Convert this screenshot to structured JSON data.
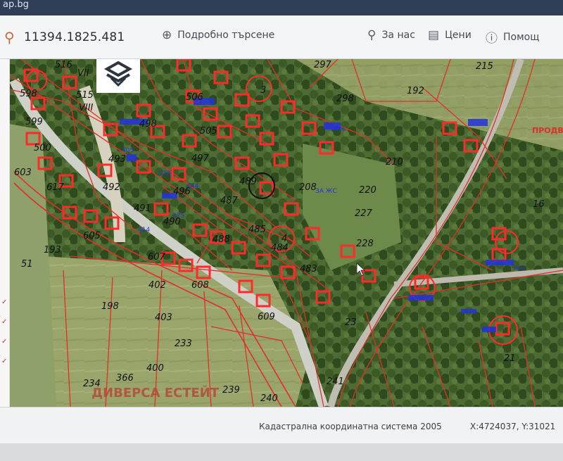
{
  "window": {
    "title_fragment": "ap.bg"
  },
  "search": {
    "value": "11394.1825.481",
    "icon": "search-icon"
  },
  "toolbar": {
    "advanced_search": "Подробно търсене",
    "about": "За нас",
    "prices": "Цени",
    "help": "Помощ"
  },
  "map": {
    "parcel_labels": [
      "516",
      "515",
      "598",
      "599",
      "500",
      "603",
      "617",
      "493",
      "492",
      "491",
      "490",
      "496",
      "497",
      "498",
      "487",
      "488",
      "489",
      "484",
      "485",
      "483",
      "605",
      "607",
      "608",
      "609",
      "402",
      "403",
      "400",
      "366",
      "234",
      "233",
      "239",
      "240",
      "241",
      "198",
      "193",
      "51",
      "297",
      "298",
      "192",
      "215",
      "210",
      "220",
      "227",
      "228",
      "208",
      "23",
      "21",
      "16",
      "3",
      "4",
      "VII",
      "VIII",
      "505",
      "506"
    ],
    "blue_labels": [
      "405",
      "378",
      "444",
      "375",
      "414",
      "ЗА ЖС",
      "ЖС",
      "20%"
    ],
    "road_label": "ПРОДВЗЕМ",
    "watermark": "ДИВЕРСА ЕСТЕЙТ"
  },
  "status": {
    "coord_system": "Кадастрална координатна система 2005",
    "coords": "X:4724037, Y:31021"
  },
  "colors": {
    "accent": "#c46a3a",
    "parcel_red": "#e0302a",
    "building_blue": "#2233dd"
  }
}
